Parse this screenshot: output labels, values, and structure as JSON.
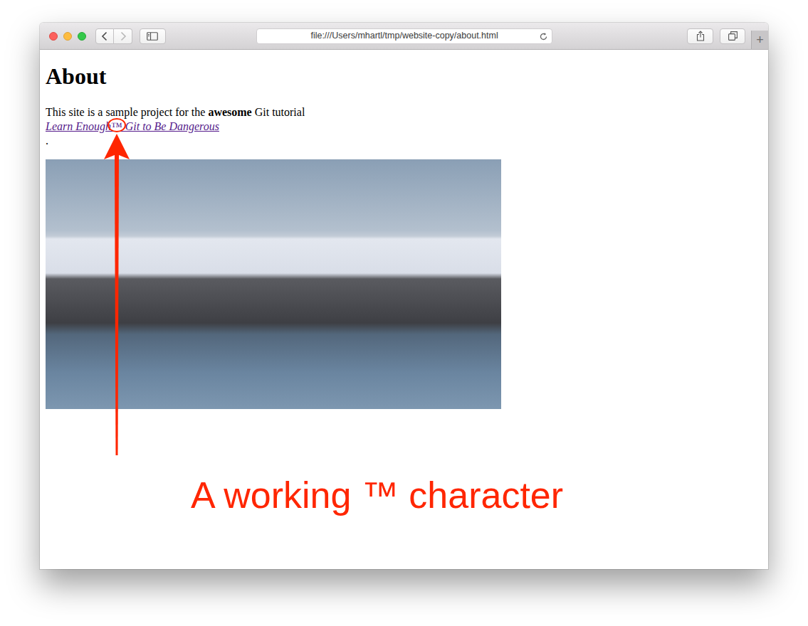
{
  "window": {
    "url": "file:///Users/mhartl/tmp/website-copy/about.html",
    "back_enabled": true,
    "forward_enabled": false,
    "new_tab_button": "+"
  },
  "page": {
    "heading": "About",
    "paragraph": {
      "before": "This site is a sample project for the ",
      "bold": "awesome",
      "middle": " Git tutorial ",
      "link": "Learn Enough™ Git to Be Dangerous",
      "link_visited": true,
      "after": "."
    }
  },
  "annotation": {
    "caption": "A working ™ character"
  }
}
